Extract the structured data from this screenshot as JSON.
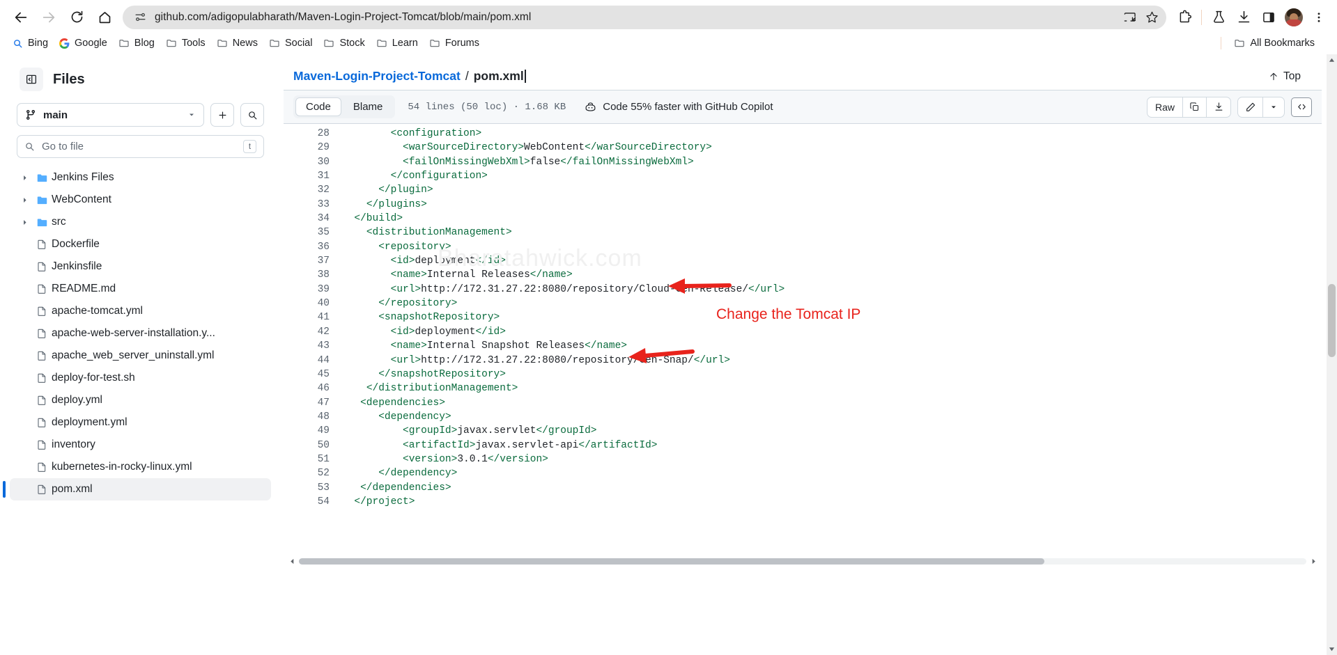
{
  "browser": {
    "back_label": "Back",
    "forward_label": "Forward",
    "reload_label": "Reload",
    "home_label": "Home",
    "url": "github.com/adigopulabharath/Maven-Login-Project-Tomcat/blob/main/pom.xml",
    "site_info_label": "View site information",
    "cast_label": "Cast this tab",
    "bookmark_label": "Bookmark this tab",
    "extensions_label": "Extensions",
    "labs_label": "Labs",
    "downloads_label": "Downloads",
    "side_panel_label": "Side panel",
    "profile_label": "Profile",
    "menu_label": "Customize and control Google Chrome"
  },
  "bookmarks": {
    "items": [
      {
        "label": "Bing",
        "icon": "bing-search-icon"
      },
      {
        "label": "Google",
        "icon": "google-icon"
      },
      {
        "label": "Blog",
        "icon": "folder-icon"
      },
      {
        "label": "Tools",
        "icon": "folder-icon"
      },
      {
        "label": "News",
        "icon": "folder-icon"
      },
      {
        "label": "Social",
        "icon": "folder-icon"
      },
      {
        "label": "Stock",
        "icon": "folder-icon"
      },
      {
        "label": "Learn",
        "icon": "folder-icon"
      },
      {
        "label": "Forums",
        "icon": "folder-icon"
      }
    ],
    "all_bookmarks_label": "All Bookmarks"
  },
  "sidebar": {
    "title": "Files",
    "toggle_label": "Hide file tree",
    "branch": "main",
    "add_label": "Add file",
    "search_label": "Search this repository",
    "search_placeholder": "Go to file",
    "search_kbd": "t",
    "tree": [
      {
        "label": "Jenkins Files",
        "type": "folder",
        "expandable": true,
        "selected": false
      },
      {
        "label": "WebContent",
        "type": "folder",
        "expandable": true,
        "selected": false
      },
      {
        "label": "src",
        "type": "folder",
        "expandable": true,
        "selected": false
      },
      {
        "label": "Dockerfile",
        "type": "file",
        "expandable": false,
        "selected": false
      },
      {
        "label": "Jenkinsfile",
        "type": "file",
        "expandable": false,
        "selected": false
      },
      {
        "label": "README.md",
        "type": "file",
        "expandable": false,
        "selected": false
      },
      {
        "label": "apache-tomcat.yml",
        "type": "file",
        "expandable": false,
        "selected": false
      },
      {
        "label": "apache-web-server-installation.y...",
        "type": "file",
        "expandable": false,
        "selected": false
      },
      {
        "label": "apache_web_server_uninstall.yml",
        "type": "file",
        "expandable": false,
        "selected": false
      },
      {
        "label": "deploy-for-test.sh",
        "type": "file",
        "expandable": false,
        "selected": false
      },
      {
        "label": "deploy.yml",
        "type": "file",
        "expandable": false,
        "selected": false
      },
      {
        "label": "deployment.yml",
        "type": "file",
        "expandable": false,
        "selected": false
      },
      {
        "label": "inventory",
        "type": "file",
        "expandable": false,
        "selected": false
      },
      {
        "label": "kubernetes-in-rocky-linux.yml",
        "type": "file",
        "expandable": false,
        "selected": false
      },
      {
        "label": "pom.xml",
        "type": "file",
        "expandable": false,
        "selected": true
      }
    ]
  },
  "file_header": {
    "repo": "Maven-Login-Project-Tomcat",
    "separator": "/",
    "filename": "pom.xml",
    "top_label": "Top"
  },
  "file_toolbar": {
    "tabs": [
      {
        "label": "Code",
        "active": true
      },
      {
        "label": "Blame",
        "active": false
      }
    ],
    "meta": "54 lines (50 loc) · 1.68 KB",
    "copilot_label": "Code 55% faster with GitHub Copilot",
    "raw_label": "Raw",
    "copy_label": "Copy raw content",
    "download_label": "Download raw file",
    "edit_label": "Edit this file",
    "edit_more_label": "More edit options",
    "symbols_label": "Open symbols panel"
  },
  "code": {
    "lines": [
      {
        "no": "28",
        "text": "        <configuration>"
      },
      {
        "no": "29",
        "text": "          <warSourceDirectory>WebContent</warSourceDirectory>"
      },
      {
        "no": "30",
        "text": "          <failOnMissingWebXml>false</failOnMissingWebXml>"
      },
      {
        "no": "31",
        "text": "        </configuration>"
      },
      {
        "no": "32",
        "text": "      </plugin>"
      },
      {
        "no": "33",
        "text": "    </plugins>"
      },
      {
        "no": "34",
        "text": "  </build>"
      },
      {
        "no": "35",
        "text": "    <distributionManagement>"
      },
      {
        "no": "36",
        "text": "      <repository>"
      },
      {
        "no": "37",
        "text": "        <id>deployment</id>"
      },
      {
        "no": "38",
        "text": "        <name>Internal Releases</name>"
      },
      {
        "no": "39",
        "text": "        <url>http://172.31.27.22:8080/repository/Cloud-Gen-Release/</url>"
      },
      {
        "no": "40",
        "text": "      </repository>"
      },
      {
        "no": "41",
        "text": "      <snapshotRepository>"
      },
      {
        "no": "42",
        "text": "        <id>deployment</id>"
      },
      {
        "no": "43",
        "text": "        <name>Internal Snapshot Releases</name>"
      },
      {
        "no": "44",
        "text": "        <url>http://172.31.27.22:8080/repository/Gen-Snap/</url>"
      },
      {
        "no": "45",
        "text": "      </snapshotRepository>"
      },
      {
        "no": "46",
        "text": "    </distributionManagement>"
      },
      {
        "no": "47",
        "text": "   <dependencies>"
      },
      {
        "no": "48",
        "text": "      <dependency>"
      },
      {
        "no": "49",
        "text": "          <groupId>javax.servlet</groupId>"
      },
      {
        "no": "50",
        "text": "          <artifactId>javax.servlet-api</artifactId>"
      },
      {
        "no": "51",
        "text": "          <version>3.0.1</version>"
      },
      {
        "no": "52",
        "text": "      </dependency>"
      },
      {
        "no": "53",
        "text": "   </dependencies>"
      },
      {
        "no": "54",
        "text": "  </project>"
      }
    ]
  },
  "annotations": {
    "note": "Change the Tomcat IP",
    "note_color": "#e8231c",
    "arrow1_label": "arrow-pointing-to-release-url",
    "arrow2_label": "arrow-pointing-to-snapshot-url"
  },
  "watermark": {
    "text": "Bharatahwick.com"
  },
  "colors": {
    "link": "#0969da",
    "tag": "#0a6b3d",
    "text": "#1f2328",
    "muted": "#59636e",
    "border": "#d1d9e0",
    "toolbar_bg": "#f6f8fa",
    "annotation_red": "#e8231c"
  }
}
